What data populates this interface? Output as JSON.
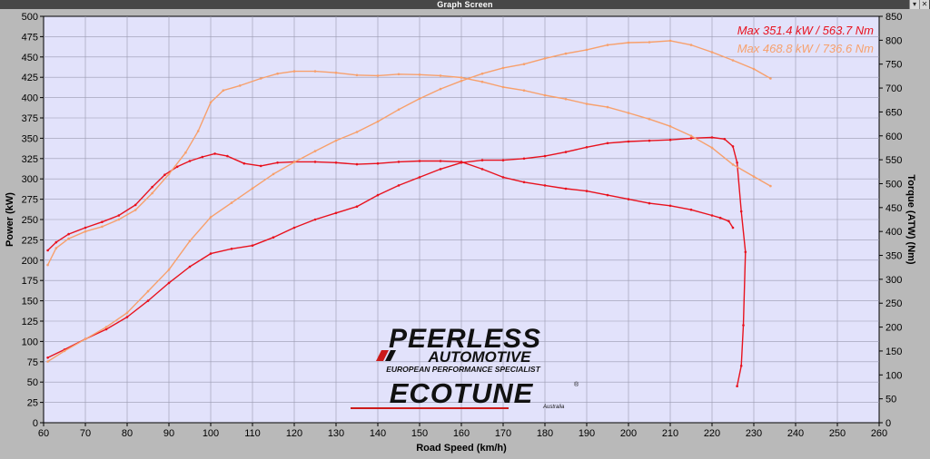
{
  "window": {
    "title": "Graph Screen",
    "minimize_icon": "minimize-icon",
    "close_icon": "close-icon",
    "minimize_glyph": "▾",
    "close_glyph": "✕"
  },
  "logo": {
    "brand": "PEERLESS",
    "brand2": "AUTOMOTIVE",
    "tagline": "EUROPEAN PERFORMANCE SPECIALIST",
    "product": "ECOTUNE",
    "product_sub": "Australia"
  },
  "chart_data": {
    "type": "line",
    "xlabel": "Road Speed (km/h)",
    "ylabel": "Power (kW)",
    "y2label": "Torque (ATW) (Nm)",
    "xlim": [
      60,
      260
    ],
    "ylim": [
      0,
      500
    ],
    "y2lim": [
      0,
      850
    ],
    "x_ticks": [
      60,
      70,
      80,
      90,
      100,
      110,
      120,
      130,
      140,
      150,
      160,
      170,
      180,
      190,
      200,
      210,
      220,
      230,
      240,
      250,
      260
    ],
    "y_ticks": [
      0,
      25,
      50,
      75,
      100,
      125,
      150,
      175,
      200,
      225,
      250,
      275,
      300,
      325,
      350,
      375,
      400,
      425,
      450,
      475,
      500
    ],
    "y2_ticks": [
      0,
      50,
      100,
      150,
      200,
      250,
      300,
      350,
      400,
      450,
      500,
      550,
      600,
      650,
      700,
      750,
      800,
      850
    ],
    "grid": true,
    "legend_placement": "top-right",
    "max_labels": [
      {
        "text": "Max 351.4 kW  / 563.7 Nm",
        "color": "#e8121e"
      },
      {
        "text": "Max 468.8 kW  / 736.6 Nm",
        "color": "#f7a06c"
      }
    ],
    "series": [
      {
        "color": "#e8121e",
        "axis": "power",
        "x": [
          61,
          63,
          66,
          70,
          74,
          78,
          82,
          86,
          89,
          92,
          95,
          98,
          101,
          104,
          108,
          112,
          116,
          120,
          125,
          130,
          135,
          140,
          145,
          150,
          155,
          160,
          165,
          170,
          175,
          180,
          185,
          190,
          195,
          200,
          205,
          210,
          215,
          220,
          222,
          224,
          225
        ],
        "y": [
          212,
          222,
          232,
          240,
          247,
          255,
          268,
          290,
          305,
          315,
          322,
          327,
          331,
          328,
          319,
          316,
          320,
          321,
          321,
          320,
          318,
          319,
          321,
          322,
          322,
          321,
          312,
          302,
          296,
          292,
          288,
          285,
          280,
          275,
          270,
          267,
          262,
          255,
          252,
          248,
          240
        ]
      },
      {
        "color": "#e8121e",
        "axis": "power",
        "x": [
          61,
          65,
          70,
          75,
          80,
          85,
          90,
          95,
          100,
          105,
          110,
          115,
          120,
          125,
          130,
          135,
          140,
          145,
          150,
          155,
          160,
          165,
          170,
          175,
          180,
          185,
          190,
          195,
          200,
          205,
          210,
          215,
          220,
          223,
          225,
          226,
          227,
          228,
          227.5,
          227,
          226
        ],
        "y": [
          80,
          90,
          103,
          115,
          130,
          150,
          172,
          192,
          208,
          214,
          218,
          228,
          240,
          250,
          258,
          266,
          280,
          292,
          302,
          312,
          320,
          323,
          323,
          325,
          328,
          333,
          339,
          344,
          346,
          347,
          348,
          350,
          351,
          349,
          340,
          320,
          260,
          210,
          120,
          70,
          45
        ]
      },
      {
        "color": "#f7a06c",
        "axis": "torque",
        "x": [
          61,
          63,
          66,
          70,
          74,
          78,
          82,
          86,
          90,
          94,
          97,
          100,
          103,
          107,
          112,
          116,
          120,
          125,
          130,
          135,
          140,
          145,
          150,
          155,
          160,
          165,
          170,
          175,
          180,
          185,
          190,
          195,
          200,
          205,
          210,
          215,
          220,
          225,
          230,
          234
        ],
        "y": [
          330,
          365,
          385,
          400,
          410,
          425,
          445,
          480,
          520,
          565,
          610,
          670,
          695,
          705,
          720,
          730,
          735,
          735,
          732,
          727,
          726,
          729,
          728,
          726,
          722,
          713,
          702,
          695,
          685,
          677,
          667,
          660,
          648,
          635,
          620,
          600,
          575,
          540,
          515,
          495
        ]
      },
      {
        "color": "#f7a06c",
        "axis": "torque",
        "x": [
          61,
          65,
          70,
          75,
          80,
          85,
          90,
          95,
          100,
          105,
          110,
          115,
          120,
          125,
          130,
          135,
          140,
          145,
          150,
          155,
          160,
          165,
          170,
          175,
          180,
          185,
          190,
          195,
          200,
          205,
          210,
          215,
          220,
          225,
          230,
          234
        ],
        "y": [
          128,
          150,
          175,
          200,
          230,
          275,
          320,
          380,
          430,
          460,
          490,
          520,
          545,
          568,
          590,
          608,
          630,
          655,
          678,
          698,
          715,
          730,
          742,
          750,
          762,
          772,
          780,
          790,
          795,
          796,
          799,
          790,
          775,
          758,
          740,
          720
        ]
      }
    ]
  }
}
